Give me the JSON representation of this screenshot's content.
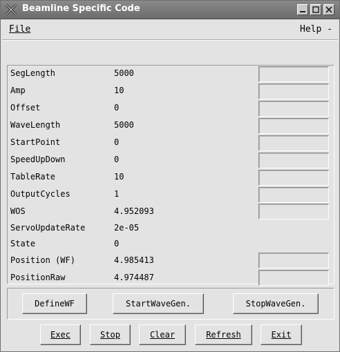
{
  "window": {
    "title": "Beamline Specific Code"
  },
  "menu": {
    "file": "File",
    "help": "Help"
  },
  "params": [
    {
      "label": "SegLength",
      "value": "5000"
    },
    {
      "label": "Amp",
      "value": "10"
    },
    {
      "label": "Offset",
      "value": "0"
    },
    {
      "label": "WaveLength",
      "value": "5000"
    },
    {
      "label": "StartPoint",
      "value": "0"
    },
    {
      "label": "SpeedUpDown",
      "value": "0"
    },
    {
      "label": "TableRate",
      "value": "10"
    },
    {
      "label": "OutputCycles",
      "value": "1"
    },
    {
      "label": "WOS",
      "value": "4.952093"
    },
    {
      "label": "ServoUpdateRate",
      "value": "2e-05"
    },
    {
      "label": "State",
      "value": "0"
    },
    {
      "label": "Position (WF)",
      "value": "4.985413"
    },
    {
      "label": "PositionRaw",
      "value": "4.974487"
    }
  ],
  "wavegen_buttons": {
    "define": "DefineWF",
    "start": "StartWaveGen.",
    "stop": "StopWaveGen."
  },
  "bottom_buttons": {
    "exec": "Exec",
    "stop": "Stop",
    "clear": "Clear",
    "refresh": "Refresh",
    "exit": "Exit"
  },
  "colors": {
    "window_bg": "#e3e3e3",
    "titlebar": "#7a7a7a"
  }
}
